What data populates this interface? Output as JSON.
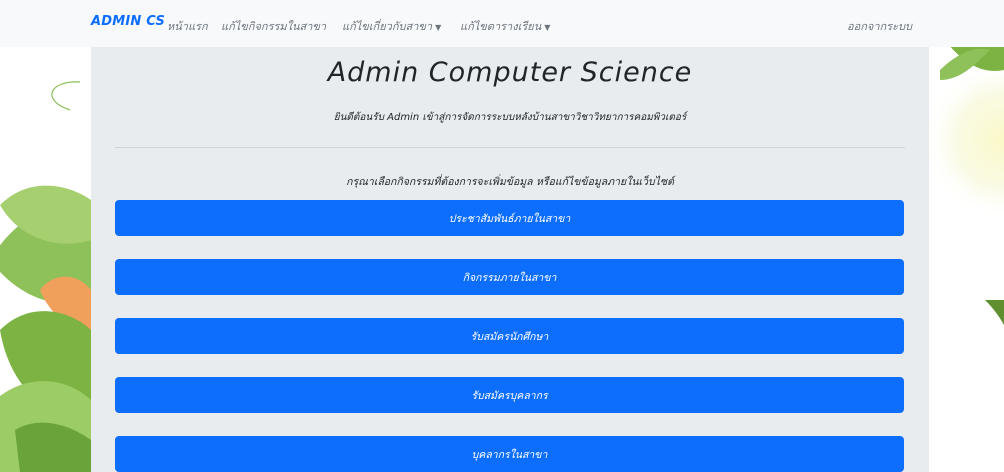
{
  "navbar": {
    "brand": "ADMIN CS",
    "links": [
      {
        "label": "หน้าแรก",
        "dropdown": false
      },
      {
        "label": "แก้ไขกิจกรรมในสาขา",
        "dropdown": false
      },
      {
        "label": "แก้ไขเกี่ยวกับสาขา",
        "dropdown": true
      },
      {
        "label": "แก้ไขตารางเรียน",
        "dropdown": true
      }
    ],
    "logout": "ออกจากระบบ"
  },
  "main": {
    "title": "Admin Computer Science",
    "subtitle": "ยินดีต้อนรับ Admin เข้าสู่การจัดการระบบหลังบ้านสาขาวิชาวิทยาการคอมพิวเตอร์",
    "prompt": "กรุณาเลือกกิจกรรมที่ต้องการจะเพิ่มข้อมูล หรือแก้ไขข้อมูลภายในเว็บไซต์",
    "buttons": [
      "ประชาสัมพันธ์ภายในสาขา",
      "กิจกรรมภายในสาขา",
      "รับสมัครนักศึกษา",
      "รับสมัครบุคลากร",
      "บุคลากรในสาขา"
    ]
  },
  "colors": {
    "primary": "#0d6efd",
    "navbar_bg": "#f8f9fa",
    "container_bg": "#e9ecef",
    "leaf_green": "#7cb342",
    "leaf_orange": "#f0a05a"
  },
  "icons": {
    "dropdown": "caret-down-icon",
    "decoration": "leaf-decoration"
  }
}
